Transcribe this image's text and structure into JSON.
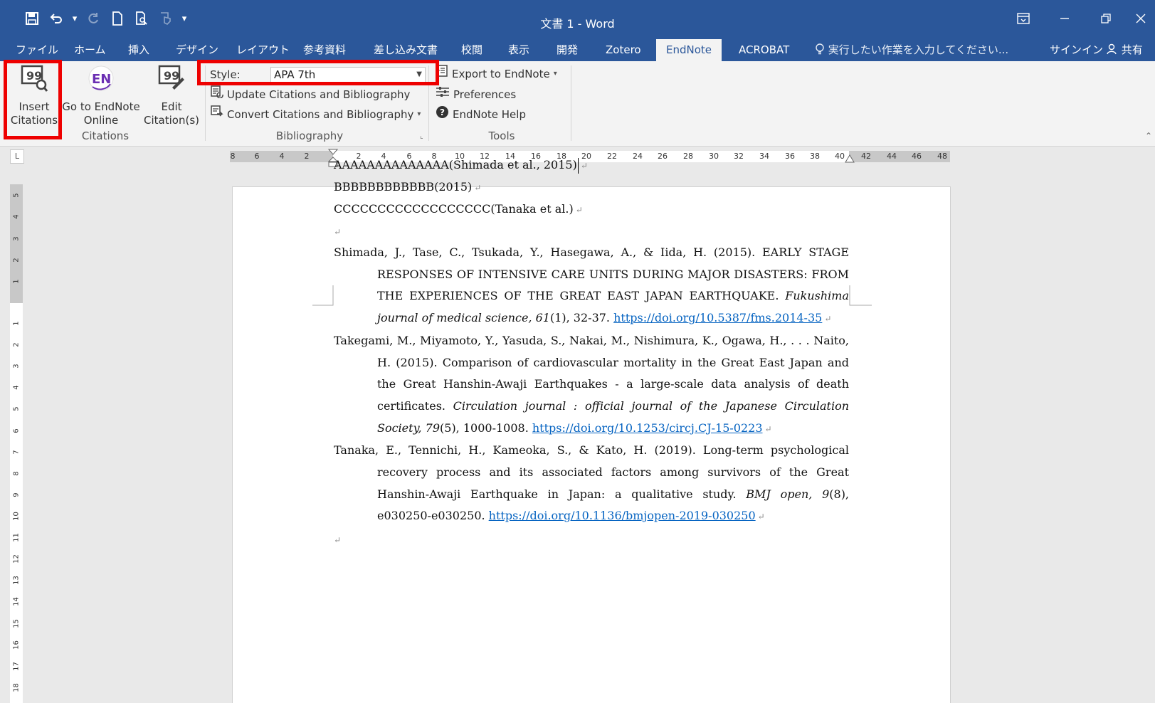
{
  "window": {
    "title": "文書 1 - Word"
  },
  "quick_access": {
    "icons": [
      "save-icon",
      "undo-icon",
      "redo-icon",
      "new-document-icon",
      "print-preview-icon",
      "touch-mode-icon",
      "customize-qat-icon"
    ]
  },
  "tabs": [
    {
      "label": "ファイル"
    },
    {
      "label": "ホーム"
    },
    {
      "label": "挿入"
    },
    {
      "label": "デザイン"
    },
    {
      "label": "レイアウト"
    },
    {
      "label": "参考資料"
    },
    {
      "label": "差し込み文書"
    },
    {
      "label": "校閲"
    },
    {
      "label": "表示"
    },
    {
      "label": "開発"
    },
    {
      "label": "Zotero"
    },
    {
      "label": "EndNote"
    },
    {
      "label": "ACROBAT"
    }
  ],
  "active_tab": "EndNote",
  "tell_me": "実行したい作業を入力してください...",
  "sign_in": "サインイン",
  "share": "共有",
  "ribbon": {
    "citations": {
      "insert": [
        "Insert",
        "Citations"
      ],
      "goto_online": [
        "Go to EndNote",
        "Online"
      ],
      "edit": [
        "Edit",
        "Citation(s)"
      ],
      "group_label": "Citations"
    },
    "bibliography": {
      "style_label": "Style:",
      "style_value": "APA 7th",
      "update": "Update Citations and Bibliography",
      "convert": "Convert Citations and Bibliography",
      "group_label": "Bibliography"
    },
    "tools": {
      "export": "Export to EndNote",
      "preferences": "Preferences",
      "help": "EndNote Help",
      "group_label": "Tools"
    }
  },
  "ruler": {
    "corner": "L",
    "h_ticks": [
      "8",
      "6",
      "4",
      "2",
      "2",
      "4",
      "6",
      "8",
      "10",
      "12",
      "14",
      "16",
      "18",
      "20",
      "22",
      "24",
      "26",
      "28",
      "30",
      "32",
      "34",
      "36",
      "38",
      "40",
      "42",
      "44",
      "46",
      "48"
    ],
    "v_ticks": [
      "5",
      "4",
      "3",
      "2",
      "1",
      "1",
      "2",
      "3",
      "4",
      "5",
      "6",
      "7",
      "8",
      "9",
      "10",
      "11",
      "12",
      "13",
      "14",
      "15",
      "16",
      "17",
      "18"
    ]
  },
  "document": {
    "citations": [
      "AAAAAAAAAAAAAA(Shimada et al., 2015)",
      "BBBBBBBBBBBB(2015)",
      "CCCCCCCCCCCCCCCCCC(Tanaka et al.)"
    ],
    "para_mark": "↵",
    "references": [
      {
        "text": "Shimada, J., Tase, C., Tsukada, Y., Hasegawa, A., & Iida, H. (2015). EARLY STAGE RESPONSES OF INTENSIVE CARE UNITS DURING MAJOR DISASTERS: FROM THE EXPERIENCES OF THE GREAT EAST JAPAN EARTHQUAKE. ",
        "journal": "Fukushima journal of medical science, 61",
        "rest": "(1), 32-37. ",
        "link": "https://doi.org/10.5387/fms.2014-35"
      },
      {
        "text": "Takegami, M., Miyamoto, Y., Yasuda, S., Nakai, M., Nishimura, K., Ogawa, H., . . . Naito, H. (2015). Comparison of cardiovascular mortality in the Great East Japan and the Great Hanshin-Awaji Earthquakes - a large-scale data analysis of death certificates. ",
        "journal": "Circulation journal : official journal of the Japanese Circulation Society, 79",
        "rest": "(5), 1000-1008. ",
        "link": "https://doi.org/10.1253/circj.CJ-15-0223"
      },
      {
        "text": "Tanaka, E., Tennichi, H., Kameoka, S., & Kato, H. (2019). Long-term psychological recovery process and its associated factors among survivors of the Great Hanshin-Awaji Earthquake in Japan: a qualitative study. ",
        "journal": "BMJ open, 9",
        "rest": "(8), e030250-e030250. ",
        "link": "https://doi.org/10.1136/bmjopen-2019-030250"
      }
    ]
  },
  "colors": {
    "word_blue": "#2b579a",
    "ribbon_bg": "#f3f3f3",
    "highlight": "#ee0000",
    "link": "#0563c1"
  }
}
